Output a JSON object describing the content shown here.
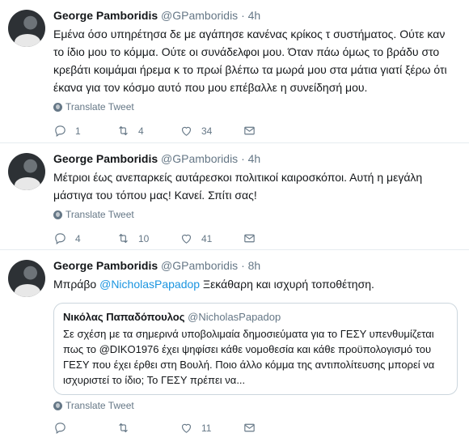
{
  "tweets": [
    {
      "name": "George Pamboridis",
      "handle": "@GPamboridis",
      "dot": "·",
      "time": "4h",
      "text": "Εμένα όσο υπηρέτησα δε με αγάπησε κανένας κρίκος τ συστήματος. Ούτε καν το ίδιο μου το κόμμα. Ούτε οι συνάδελφοι μου. Όταν πάω όμως το βράδυ στο κρεβάτι κοιμάμαι ήρεμα κ το πρωί βλέπω τα μωρά μου στα μάτια γιατί ξέρω ότι έκανα για τον κόσμο αυτό που μου επέβαλλε η συνείδησή μου.",
      "translate": "Translate Tweet",
      "replies": "1",
      "retweets": "4",
      "likes": "34"
    },
    {
      "name": "George Pamboridis",
      "handle": "@GPamboridis",
      "dot": "·",
      "time": "4h",
      "text": "Μέτριοι έως ανεπαρκείς αυτάρεσκοι πολιτικοί καιροσκόποι. Αυτή η μεγάλη μάστιγα του τόπου μας! Κανεί. Σπίτι σας!",
      "translate": "Translate Tweet",
      "replies": "4",
      "retweets": "10",
      "likes": "41"
    },
    {
      "name": "George Pamboridis",
      "handle": "@GPamboridis",
      "dot": "·",
      "time": "8h",
      "text_prefix": "Μπράβο ",
      "mention": "@NicholasPapadop",
      "text_suffix": " Ξεκάθαρη και ισχυρή τοποθέτηση.",
      "quote": {
        "name": "Νικόλας Παπαδόπουλος",
        "handle": "@NicholasPapadop",
        "text": "Σε σχέση με τα σημερινά υποβολιμαία δημοσιεύματα για το ΓΕΣΥ υπενθυμίζεται πως το @DIKO1976  έχει ψηφίσει  κάθε νομοθεσία και κάθε προϋπολογισμό του ΓΕΣΥ που έχει έρθει στη Βουλή. Ποιο άλλο κόμμα της αντιπολίτευσης μπορεί να ισχυριστεί το ίδιο; Το ΓΕΣΥ πρέπει να..."
      },
      "translate": "Translate Tweet",
      "replies": "",
      "retweets": "",
      "likes": "11"
    }
  ],
  "icons": {
    "reply": "reply-icon",
    "retweet": "retweet-icon",
    "like": "heart-icon",
    "message": "envelope-icon",
    "translate": "globe-icon"
  },
  "colors": {
    "link": "#1b95e0",
    "secondary": "#657786",
    "border": "#e6ecf0"
  }
}
